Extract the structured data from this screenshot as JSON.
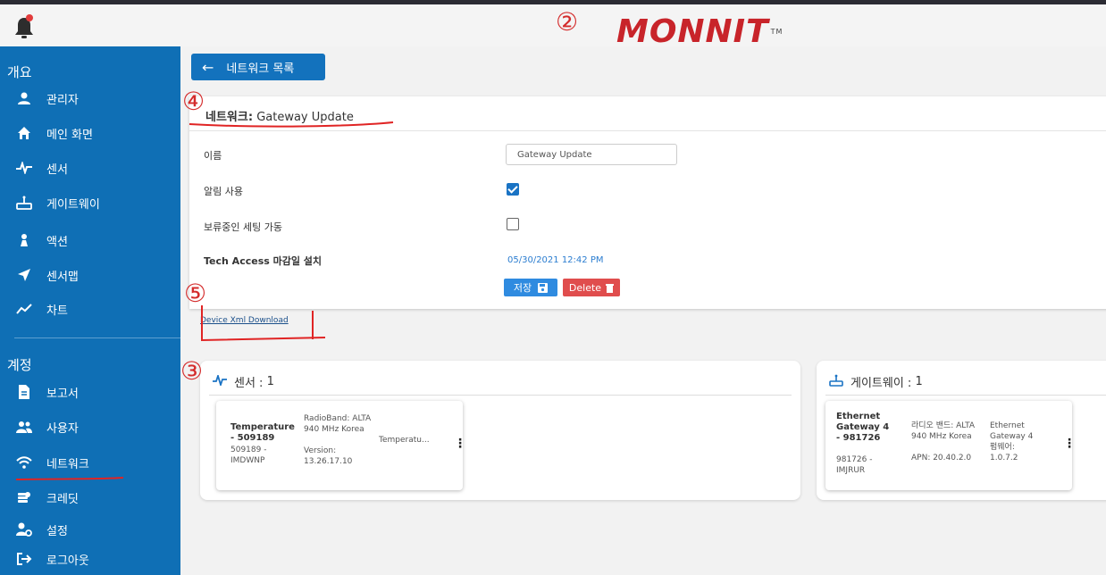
{
  "colors": {
    "sidebar": "#0f6fb5",
    "primary": "#1372bd",
    "danger": "#e04d4d",
    "brand": "#c8242a",
    "annotation": "#d42c2c"
  },
  "header": {
    "brand": "MONNIT",
    "brand_mark": "TM",
    "bell_icon": "bell-icon"
  },
  "annotations": [
    "②",
    "④",
    "⑤",
    "③"
  ],
  "sidebar": {
    "section1": "개요",
    "items1": [
      {
        "icon": "user-icon",
        "label": "관리자"
      },
      {
        "icon": "home-icon",
        "label": "메인 화면"
      },
      {
        "icon": "pulse-icon",
        "label": "센서"
      },
      {
        "icon": "router-icon",
        "label": "게이트웨이"
      },
      {
        "icon": "action-icon",
        "label": "액션"
      },
      {
        "icon": "location-arrow-icon",
        "label": "센서맵"
      },
      {
        "icon": "line-chart-icon",
        "label": "차트"
      }
    ],
    "section2": "계정",
    "items2": [
      {
        "icon": "file-icon",
        "label": "보고서"
      },
      {
        "icon": "users-icon",
        "label": "사용자"
      },
      {
        "icon": "wifi-icon",
        "label": "네트워크"
      },
      {
        "icon": "coins-icon",
        "label": "크레딧"
      },
      {
        "icon": "user-settings-icon",
        "label": "설정"
      },
      {
        "icon": "logout-icon",
        "label": "로그아웃"
      }
    ]
  },
  "main": {
    "back_label": "네트워크 목록",
    "network": {
      "title_prefix": "네트워크:",
      "title_value": "Gateway Update",
      "name_label": "이름",
      "name_value": "Gateway Update",
      "alerts_label": "알림 사용",
      "alerts_checked": true,
      "pending_label": "보류중인 세팅 가동",
      "pending_checked": false,
      "tech_label": "Tech Access 마감일 설치",
      "tech_value": "05/30/2021 12:42 PM",
      "save_label": "저장",
      "delete_label": "Delete"
    },
    "xml_link": "Device Xml Download",
    "sensors": {
      "title": "센서 :",
      "count": "1",
      "device": {
        "name": "Temperature - 509189",
        "id": "509189 - IMDWNP",
        "radio": "RadioBand: ALTA 940 MHz Korea",
        "version": "Version: 13.26.17.10",
        "type": "Temperatu..."
      }
    },
    "gateways": {
      "title": "게이트웨이 :",
      "count": "1",
      "device": {
        "name": "Ethernet Gateway 4 - 981726",
        "id": "981726 - IMJRUR",
        "radio": "라디오 밴드: ALTA 940 MHz Korea",
        "apn": "APN: 20.40.2.0",
        "type": "Ethernet Gateway 4",
        "firmware": "펌웨어: 1.0.7.2"
      }
    }
  }
}
